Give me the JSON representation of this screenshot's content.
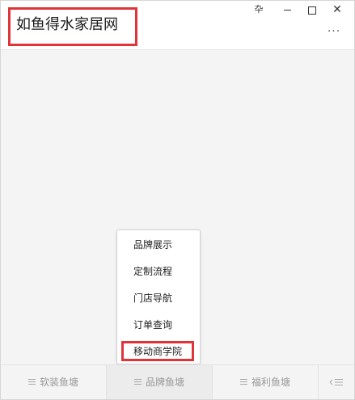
{
  "window": {
    "title": "如鱼得水家居网",
    "pin_glyph": "卆",
    "close_glyph": "✕",
    "more_glyph": "···",
    "highlight_color": "#e0343a"
  },
  "popup_menu": {
    "items": [
      "品牌展示",
      "定制流程",
      "门店导航",
      "订单查询",
      "移动商学院"
    ],
    "highlighted_item": "移动商学院"
  },
  "tabbar": {
    "tabs": [
      {
        "label": "软装鱼塘",
        "icon": "menu-icon"
      },
      {
        "label": "品牌鱼塘",
        "icon": "menu-icon",
        "active": true
      },
      {
        "label": "福利鱼塘",
        "icon": "menu-icon"
      }
    ],
    "collapse_icon": "keyboard-toggle-icon"
  }
}
